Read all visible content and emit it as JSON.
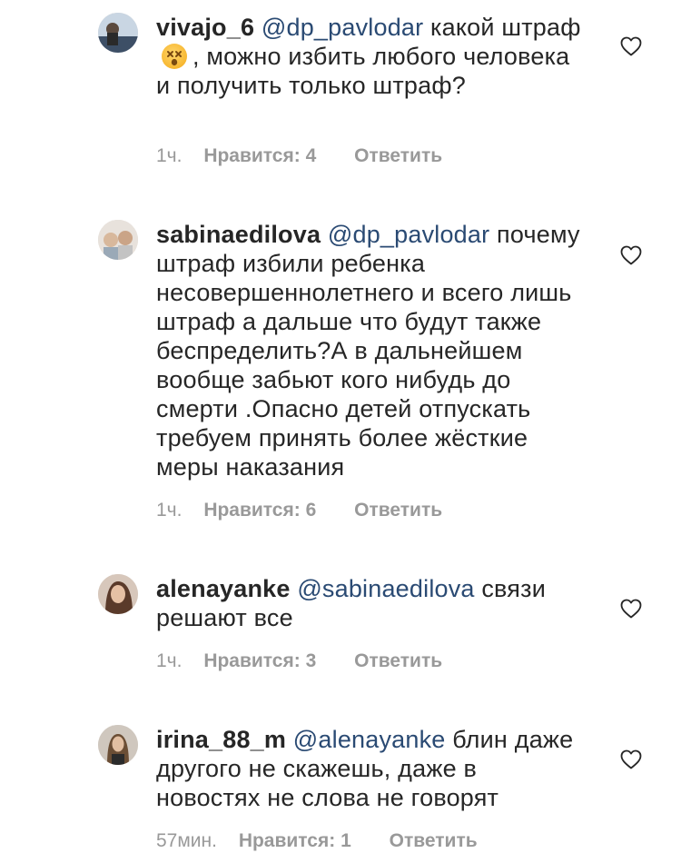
{
  "comments": [
    {
      "username": "vivajo_6",
      "mention": "@dp_pavlodar",
      "text_before_emoji": "какой штраф",
      "emoji_icon": "dizzy-face-emoji",
      "text_after_emoji": ", можно избить любого человека и получить только штраф?",
      "time": "1ч.",
      "likes": "Нравится: 4",
      "reply": "Ответить"
    },
    {
      "username": "sabinaedilova",
      "mention": "@dp_pavlodar",
      "text": "почему штраф избили ребенка несовершеннолетнего и всего лишь штраф а дальше что будут также беспределить?А в дальнейшем вообще забьют кого нибудь до смерти .Опасно детей отпускать требуем принять более жёсткие меры наказания",
      "time": "1ч.",
      "likes": "Нравится: 6",
      "reply": "Ответить"
    },
    {
      "username": "alenayanke",
      "mention": "@sabinaedilova",
      "text": "связи решают все",
      "time": "1ч.",
      "likes": "Нравится: 3",
      "reply": "Ответить"
    },
    {
      "username": "irina_88_m",
      "mention": "@alenayanke",
      "text": "блин даже другого не скажешь, даже в новостях не слова не говорят",
      "time": "57мин.",
      "likes": "Нравится: 1",
      "reply": "Ответить"
    }
  ],
  "icons": {
    "like": "heart-outline-icon"
  }
}
